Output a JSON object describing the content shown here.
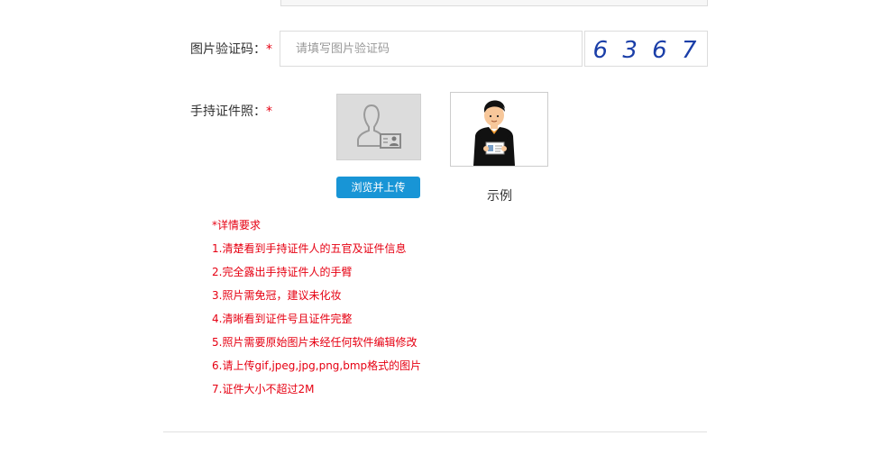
{
  "captcha": {
    "label": "图片验证码：",
    "required_mark": "*",
    "placeholder": "请填写图片验证码",
    "value": "",
    "image_text": "6 3 6 7"
  },
  "photo": {
    "label": "手持证件照：",
    "required_mark": "*",
    "upload_button": "浏览并上传",
    "example_label": "示例"
  },
  "requirements": {
    "title": "*详情要求",
    "items": [
      "1.清楚看到手持证件人的五官及证件信息",
      "2.完全露出手持证件人的手臂",
      "3.照片需免冠，建议未化妆",
      "4.清晰看到证件号且证件完整",
      "5.照片需要原始图片未经任何软件编辑修改",
      "6.请上传gif,jpeg,jpg,png,bmp格式的图片",
      "7.证件大小不超过2M"
    ]
  },
  "colors": {
    "required": "#e60012",
    "button": "#1895d6",
    "captcha_text": "#1a3ea8"
  },
  "icons": {
    "upload_placeholder": "person-id-card-icon",
    "example": "person-holding-id-illustration"
  }
}
